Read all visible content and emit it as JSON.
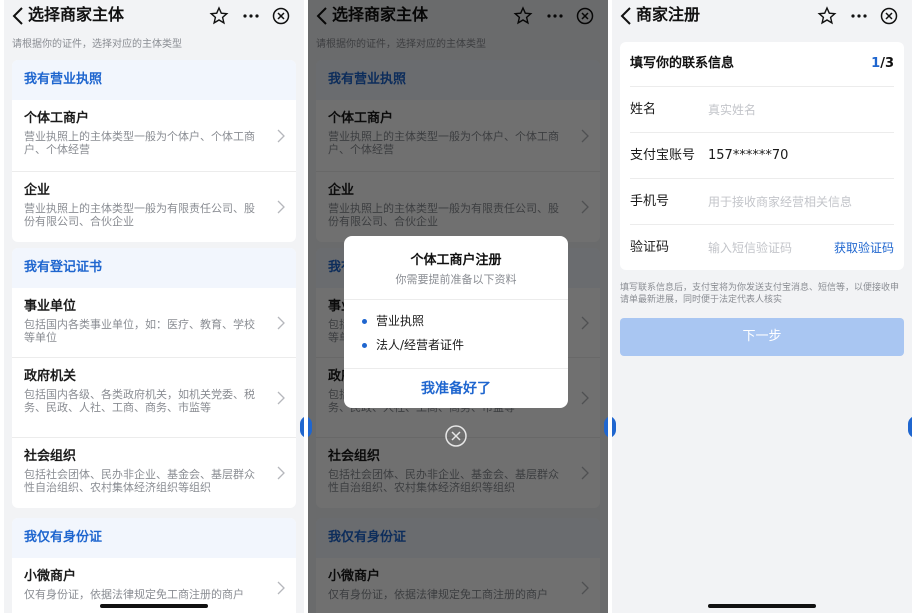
{
  "screen1": {
    "nav": {
      "title": "选择商家主体"
    },
    "hint": "请根据你的证件，选择对应的主体类型",
    "sections": [
      {
        "title": "我有营业执照",
        "items": [
          {
            "title": "个体工商户",
            "desc": "营业执照上的主体类型一般为个体户、个体工商户、个体经营"
          },
          {
            "title": "企业",
            "desc": "营业执照上的主体类型一般为有限责任公司、股份有限公司、合伙企业"
          }
        ]
      },
      {
        "title": "我有登记证书",
        "items": [
          {
            "title": "事业单位",
            "desc": "包括国内各类事业单位，如：医疗、教育、学校等单位"
          },
          {
            "title": "政府机关",
            "desc": "包括国内各级、各类政府机关，如机关党委、税务、民政、人社、工商、商务、市监等"
          },
          {
            "title": "社会组织",
            "desc": "包括社会团体、民办非企业、基金会、基层群众性自治组织、农村集体经济组织等组织"
          }
        ]
      },
      {
        "title": "我仅有身份证",
        "items": [
          {
            "title": "小微商户",
            "desc": "仅有身份证，依据法律规定免工商注册的商户"
          }
        ]
      }
    ]
  },
  "screen2": {
    "dialog": {
      "title": "个体工商户注册",
      "subtitle": "你需要提前准备以下资料",
      "items": [
        "营业执照",
        "法人/经营者证件"
      ],
      "confirm_label": "我准备好了"
    }
  },
  "screen3": {
    "nav": {
      "title": "商家注册"
    },
    "form": {
      "header": "填写你的联系信息",
      "step_current": "1",
      "step_total": "/3",
      "name_label": "姓名",
      "name_placeholder": "真实姓名",
      "alipay_label": "支付宝账号",
      "alipay_value": "157******70",
      "phone_label": "手机号",
      "phone_placeholder": "用于接收商家经营相关信息",
      "code_label": "验证码",
      "code_placeholder": "输入短信验证码",
      "get_code_label": "获取验证码"
    },
    "notice": "填写联系信息后，支付宝将为你发送支付宝消息、短信等，以便接收申请单最新进展，同时便于法定代表人核实",
    "next_label": "下一步"
  },
  "colors": {
    "accent": "#1f66cf",
    "section_bg": "#f2f6fd",
    "disabled_button": "#a9c6f2"
  }
}
